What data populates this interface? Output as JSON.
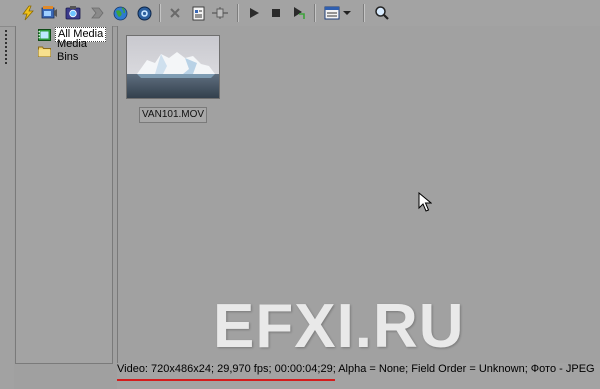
{
  "toolbar": {
    "buttons": [
      {
        "name": "import-media-button",
        "icon": "lightning-icon"
      },
      {
        "name": "capture-video-button",
        "icon": "camcorder-icon"
      },
      {
        "name": "get-photo-button",
        "icon": "camera-icon"
      },
      {
        "name": "burn-disc-button",
        "icon": "chevron-icon"
      },
      {
        "name": "web-media-button",
        "icon": "globe-icon"
      },
      {
        "name": "media-fx-button",
        "icon": "fx-globe-icon"
      },
      {
        "name": "remove-button",
        "icon": "x-icon"
      },
      {
        "name": "properties-button",
        "icon": "properties-icon"
      },
      {
        "name": "media-plugins-button",
        "icon": "plugin-icon"
      },
      {
        "name": "play-button",
        "icon": "play-icon"
      },
      {
        "name": "stop-button",
        "icon": "stop-icon"
      },
      {
        "name": "auto-preview-button",
        "icon": "auto-preview-icon"
      },
      {
        "name": "views-button",
        "icon": "views-icon"
      },
      {
        "name": "views-dropdown-button",
        "icon": "dropdown-arrow-icon"
      },
      {
        "name": "search-button",
        "icon": "magnifier-icon"
      }
    ]
  },
  "tree": {
    "items": [
      {
        "label": "All Media",
        "icon": "film-folder-icon",
        "selected": true
      },
      {
        "label": "Media Bins",
        "icon": "folder-icon",
        "selected": false
      }
    ]
  },
  "media": {
    "items": [
      {
        "filename": "VAN101.MOV",
        "thumbnail": "iceberg-thumbnail"
      }
    ]
  },
  "status": {
    "text": "Video: 720x486x24; 29,970 fps; 00:00:04;29; Alpha = None; Field Order = Unknown; Фото - JPEG"
  },
  "watermark": {
    "text": "EFXI.RU"
  },
  "colors": {
    "background": "#a0a0a0",
    "status_underline": "#d41c1c",
    "watermark": "#e9e9e9"
  }
}
